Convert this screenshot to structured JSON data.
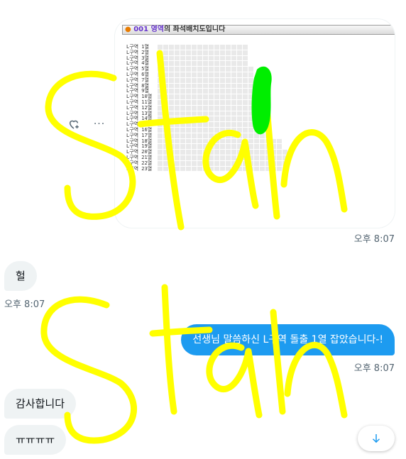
{
  "corner_mark": "˙",
  "image": {
    "header_dot": "●",
    "header_number": "001 영역",
    "header_rest": "의 좌석배치도입니다",
    "row_labels": [
      "L구역 1열",
      "L구역 2열",
      "L구역 3열",
      "L구역 4열",
      "L구역 5열",
      "L구역 6열",
      "L구역 7열",
      "L구역 8열",
      "L구역 9열",
      "L구역 10열",
      "L구역 11열",
      "L구역 12열",
      "L구역 13열",
      "L구역 14열",
      "L구역 15열",
      "L구역 16열",
      "L구역 17열",
      "L구역 18열",
      "L구역 19열",
      "L구역 20열",
      "L구역 21열",
      "L구역 22열",
      "L구역 23열"
    ]
  },
  "actions": {
    "react_icon": "heart-plus-icon",
    "more_icon": "more-icon",
    "more_glyph": "···"
  },
  "messages": [
    {
      "side": "out",
      "kind": "image",
      "time": "오후 8:07"
    },
    {
      "side": "in",
      "text": "헐",
      "time": "오후 8:07"
    },
    {
      "side": "out",
      "text": "선생님 말씀하신 L구역 돌출 1열 잡았습니다-!",
      "time": "오후 8:07"
    },
    {
      "side": "in",
      "text": "감사합니다"
    },
    {
      "side": "in",
      "text": "ㅠㅠㅠㅠ"
    }
  ],
  "scroll_down": {
    "icon": "arrow-down-icon"
  },
  "colors": {
    "accent": "#1d9bf0",
    "bubble_in": "#eff3f4",
    "scribble": "#ffff00",
    "highlight": "#00ee00"
  }
}
